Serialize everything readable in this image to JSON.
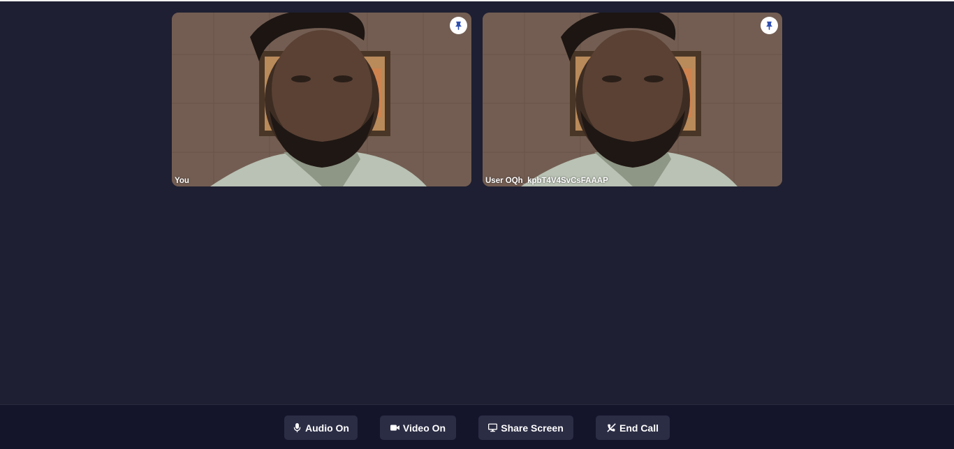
{
  "participants": [
    {
      "label": "You",
      "pin_icon": "pin-icon"
    },
    {
      "label": "User OQh_kpbT4V4SvCsFAAAP",
      "pin_icon": "pin-icon"
    }
  ],
  "controls": {
    "audio": {
      "label": "Audio On",
      "icon": "microphone-icon"
    },
    "video": {
      "label": "Video On",
      "icon": "video-camera-icon"
    },
    "share": {
      "label": "Share Screen",
      "icon": "desktop-icon"
    },
    "end": {
      "label": "End Call",
      "icon": "phone-slash-icon"
    }
  },
  "colors": {
    "background": "#1e1f32",
    "control_bar": "#14142a",
    "button": "#2b2d45",
    "pin_accent": "#2f4fb0"
  }
}
